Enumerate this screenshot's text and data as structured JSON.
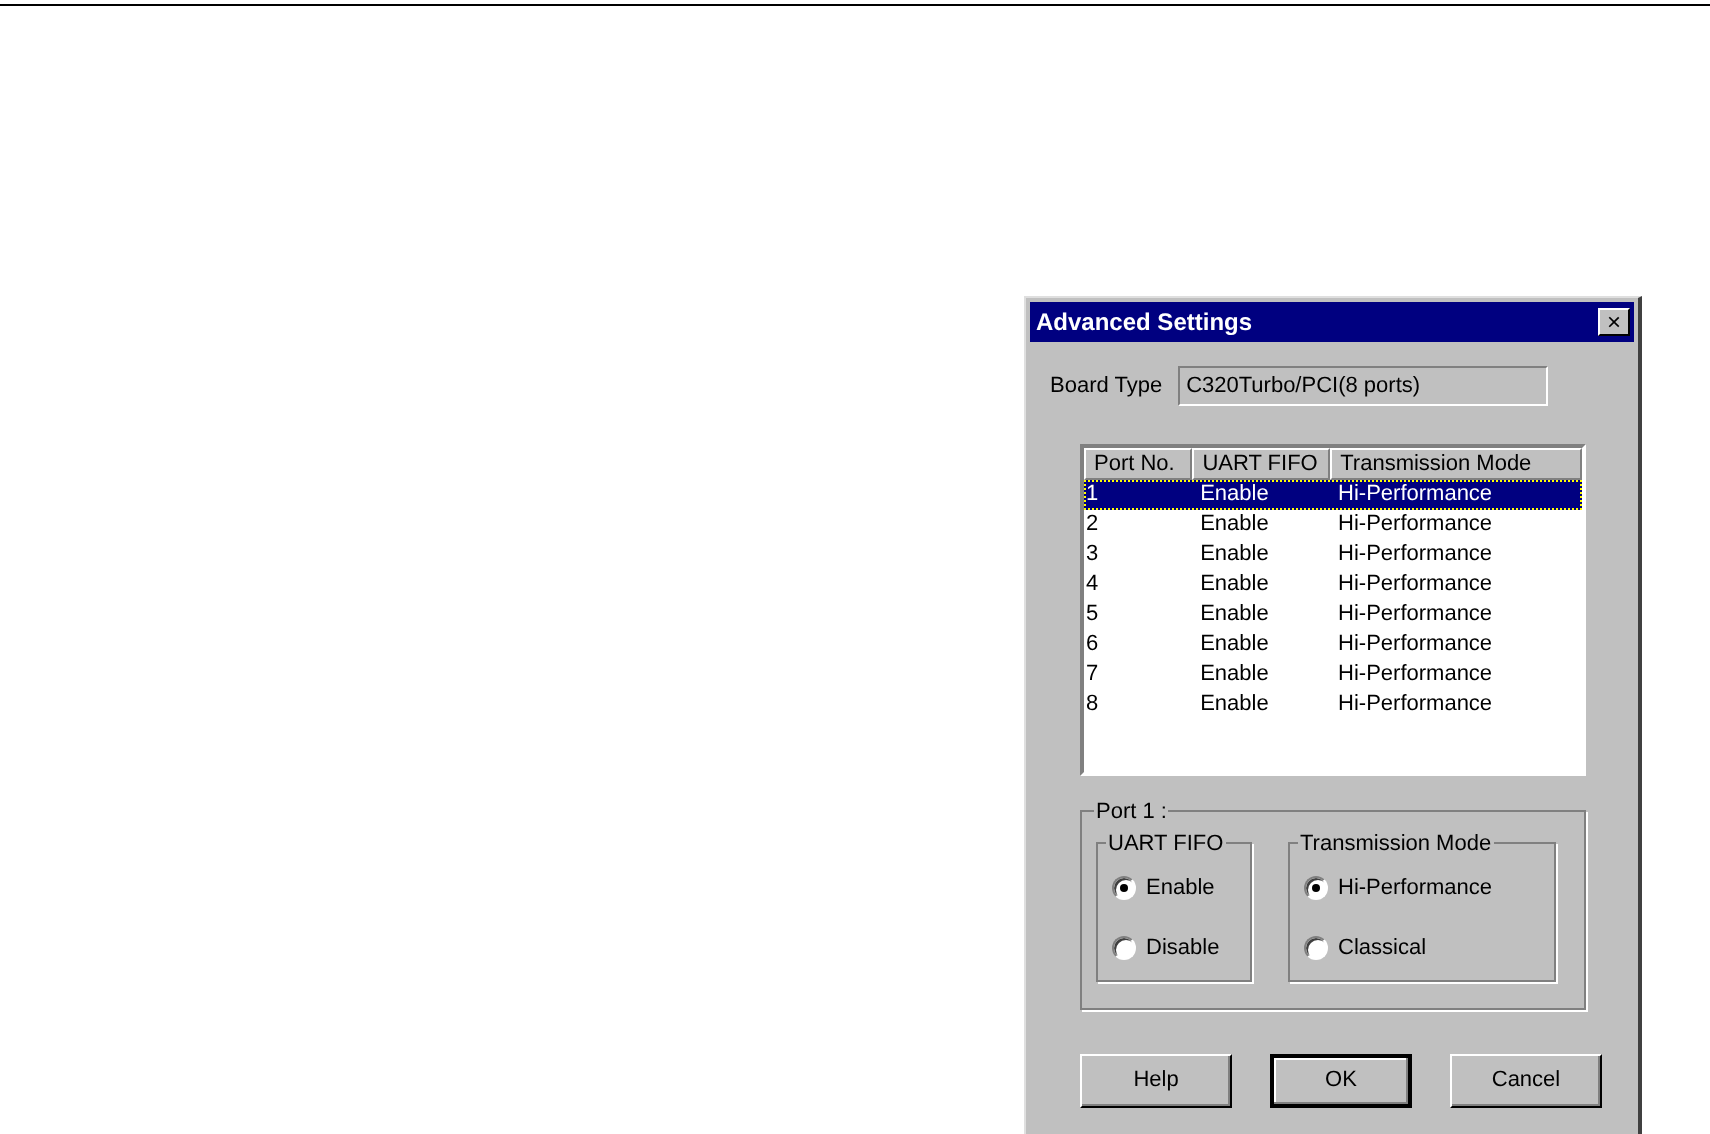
{
  "window": {
    "title": "Advanced Settings",
    "close": "×"
  },
  "board_type": {
    "label": "Board Type",
    "value": "C320Turbo/PCI(8 ports)"
  },
  "table": {
    "columns": [
      "Port No.",
      "UART FIFO",
      "Transmission Mode"
    ],
    "rows": [
      {
        "cells": [
          "1",
          "Enable",
          "Hi-Performance"
        ],
        "selected": true
      },
      {
        "cells": [
          "2",
          "Enable",
          "Hi-Performance"
        ],
        "selected": false
      },
      {
        "cells": [
          "3",
          "Enable",
          "Hi-Performance"
        ],
        "selected": false
      },
      {
        "cells": [
          "4",
          "Enable",
          "Hi-Performance"
        ],
        "selected": false
      },
      {
        "cells": [
          "5",
          "Enable",
          "Hi-Performance"
        ],
        "selected": false
      },
      {
        "cells": [
          "6",
          "Enable",
          "Hi-Performance"
        ],
        "selected": false
      },
      {
        "cells": [
          "7",
          "Enable",
          "Hi-Performance"
        ],
        "selected": false
      },
      {
        "cells": [
          "8",
          "Enable",
          "Hi-Performance"
        ],
        "selected": false
      }
    ]
  },
  "port_group": {
    "title": "Port 1 :",
    "groups": [
      {
        "title": "UART FIFO",
        "options": [
          {
            "label": "Enable",
            "selected": true
          },
          {
            "label": "Disable",
            "selected": false
          }
        ]
      },
      {
        "title": "Transmission Mode",
        "options": [
          {
            "label": "Hi-Performance",
            "selected": true
          },
          {
            "label": "Classical",
            "selected": false
          }
        ]
      }
    ]
  },
  "buttons": [
    {
      "label": "Help",
      "default": false
    },
    {
      "label": "OK",
      "default": true
    },
    {
      "label": "Cancel",
      "default": false
    }
  ]
}
